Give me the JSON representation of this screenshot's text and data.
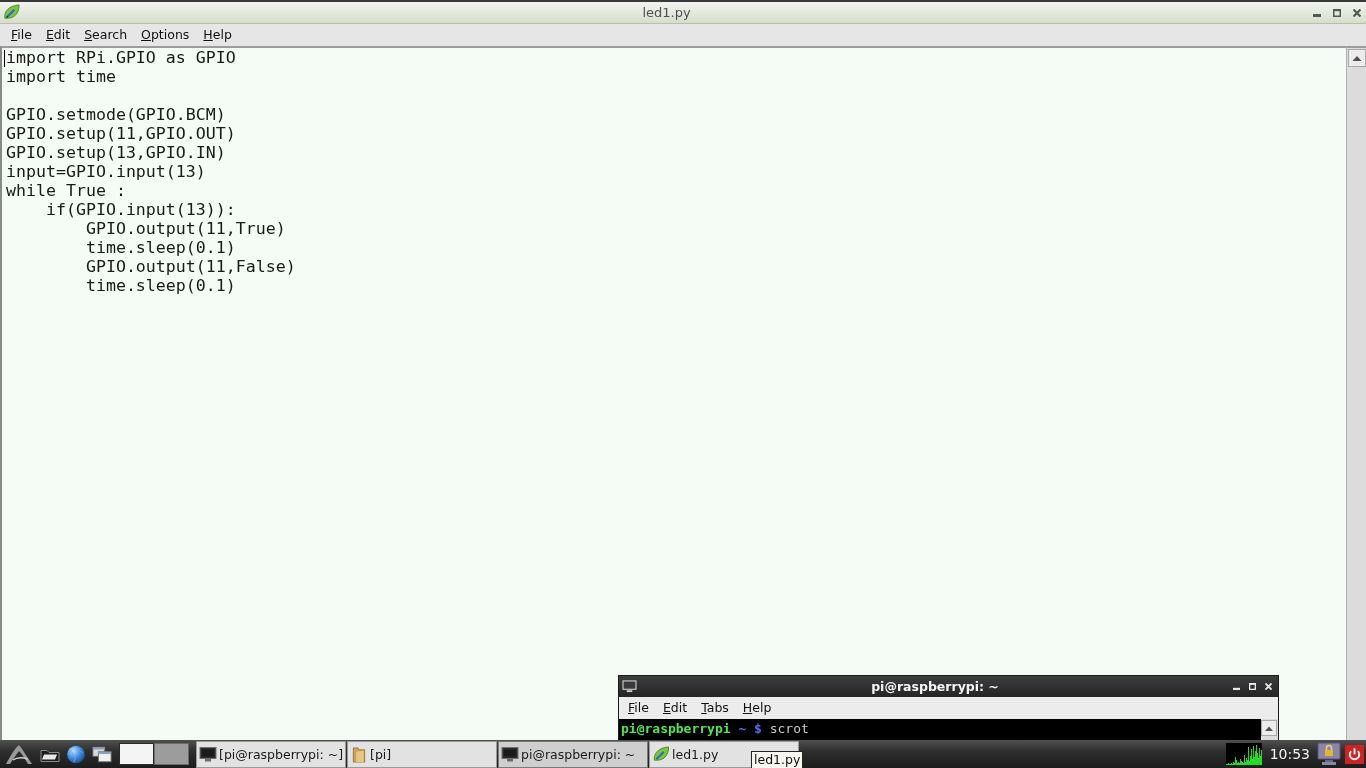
{
  "editor_window": {
    "title": "led1.py",
    "menu": [
      "File",
      "Edit",
      "Search",
      "Options",
      "Help"
    ],
    "text": "import RPi.GPIO as GPIO\nimport time\n\nGPIO.setmode(GPIO.BCM)\nGPIO.setup(11,GPIO.OUT)\nGPIO.setup(13,GPIO.IN)\ninput=GPIO.input(13)\nwhile True :\n    if(GPIO.input(13)):\n        GPIO.output(11,True)\n        time.sleep(0.1)\n        GPIO.output(11,False)\n        time.sleep(0.1)"
  },
  "terminal_window": {
    "title": "pi@raspberrypi: ~",
    "menu": [
      "File",
      "Edit",
      "Tabs",
      "Help"
    ],
    "lines": [
      {
        "user_host": "pi@raspberrypi",
        "path": "~",
        "symbol": "$",
        "command": "scrot"
      }
    ]
  },
  "taskbar": {
    "desktops": [
      {
        "selected": true
      },
      {
        "selected": false
      }
    ],
    "tasks": [
      {
        "label": "[pi@raspberrypi: ~]",
        "kind": "terminal",
        "selected": false
      },
      {
        "label": "[pi]",
        "kind": "folder",
        "selected": false
      },
      {
        "label": "pi@raspberrypi: ~",
        "kind": "terminal",
        "selected": true
      },
      {
        "label": "led1.py",
        "kind": "editor",
        "selected": false
      }
    ],
    "clock": "10:53",
    "tooltip": "led1.py"
  }
}
